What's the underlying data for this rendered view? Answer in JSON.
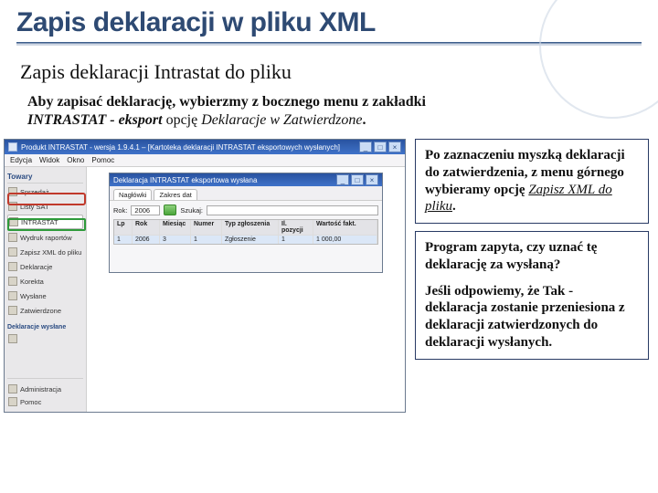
{
  "title": "Zapis deklaracji w pliku XML",
  "subhead": "Zapis deklaracji Intrastat do pliku",
  "intro": {
    "l1_a": "Aby zapisać deklarację, wybierzmy z bocznego menu z zakładki",
    "l2_a": "INTRASTAT - eksport",
    "l2_b": "  opcję ",
    "l2_c": "Deklaracje w Zatwierdzone",
    "dot": "."
  },
  "app": {
    "win_title": "Produkt INTRASTAT - wersja 1.9.4.1 – [Kartoteka deklaracji INTRASTAT eksportowych wysłanych]",
    "menu": [
      "Edycja",
      "Widok",
      "Okno",
      "Pomoc"
    ],
    "sidebar": {
      "head": "Towary",
      "items": [
        "Sprzedaż",
        "Listy SAT",
        "INTRASTAT",
        "Wydruk raportów",
        "Zapisz XML do pliku",
        "Deklaracje",
        "Korekta",
        "Wysłane",
        "Zatwierdzone"
      ],
      "group2_label": "Deklaracje wysłane",
      "footer": [
        "Administracja",
        "Pomoc"
      ]
    },
    "inner": {
      "title": "Deklaracja INTRASTAT eksportowa wysłana",
      "tabs": [
        "Nagłówki",
        "Zakres dat"
      ],
      "filter": {
        "rok_label": "Rok:",
        "rok": "2006",
        "szukaj_label": "Szukaj:"
      },
      "grid_head": {
        "lp": "Lp",
        "rok": "Rok",
        "m": "Miesiąc",
        "num": "Numer",
        "typ": "Typ zgłoszenia",
        "poz": "Il. pozycji",
        "war": "Wartość fakt."
      },
      "row": {
        "lp": "1",
        "rok": "2006",
        "m": "3",
        "num": "1",
        "typ": "Zgłoszenie",
        "poz": "1",
        "war": "1 000,00"
      }
    },
    "winbtns": {
      "min": "_",
      "max": "□",
      "close": "×"
    }
  },
  "callouts": {
    "c1_a": "Po zaznaczeniu myszką deklaracji do zatwierdzenia, z menu górnego wybieramy opcję ",
    "c1_b": "Zapisz XML do pliku",
    "c1_c": ".",
    "c2_a": "Program zapyta, czy uznać tę deklarację za wysłaną?",
    "c2_b": "Jeśli odpowiemy, że Tak - deklaracja zostanie przeniesiona z deklaracji zatwierdzonych do deklaracji wysłanych."
  }
}
